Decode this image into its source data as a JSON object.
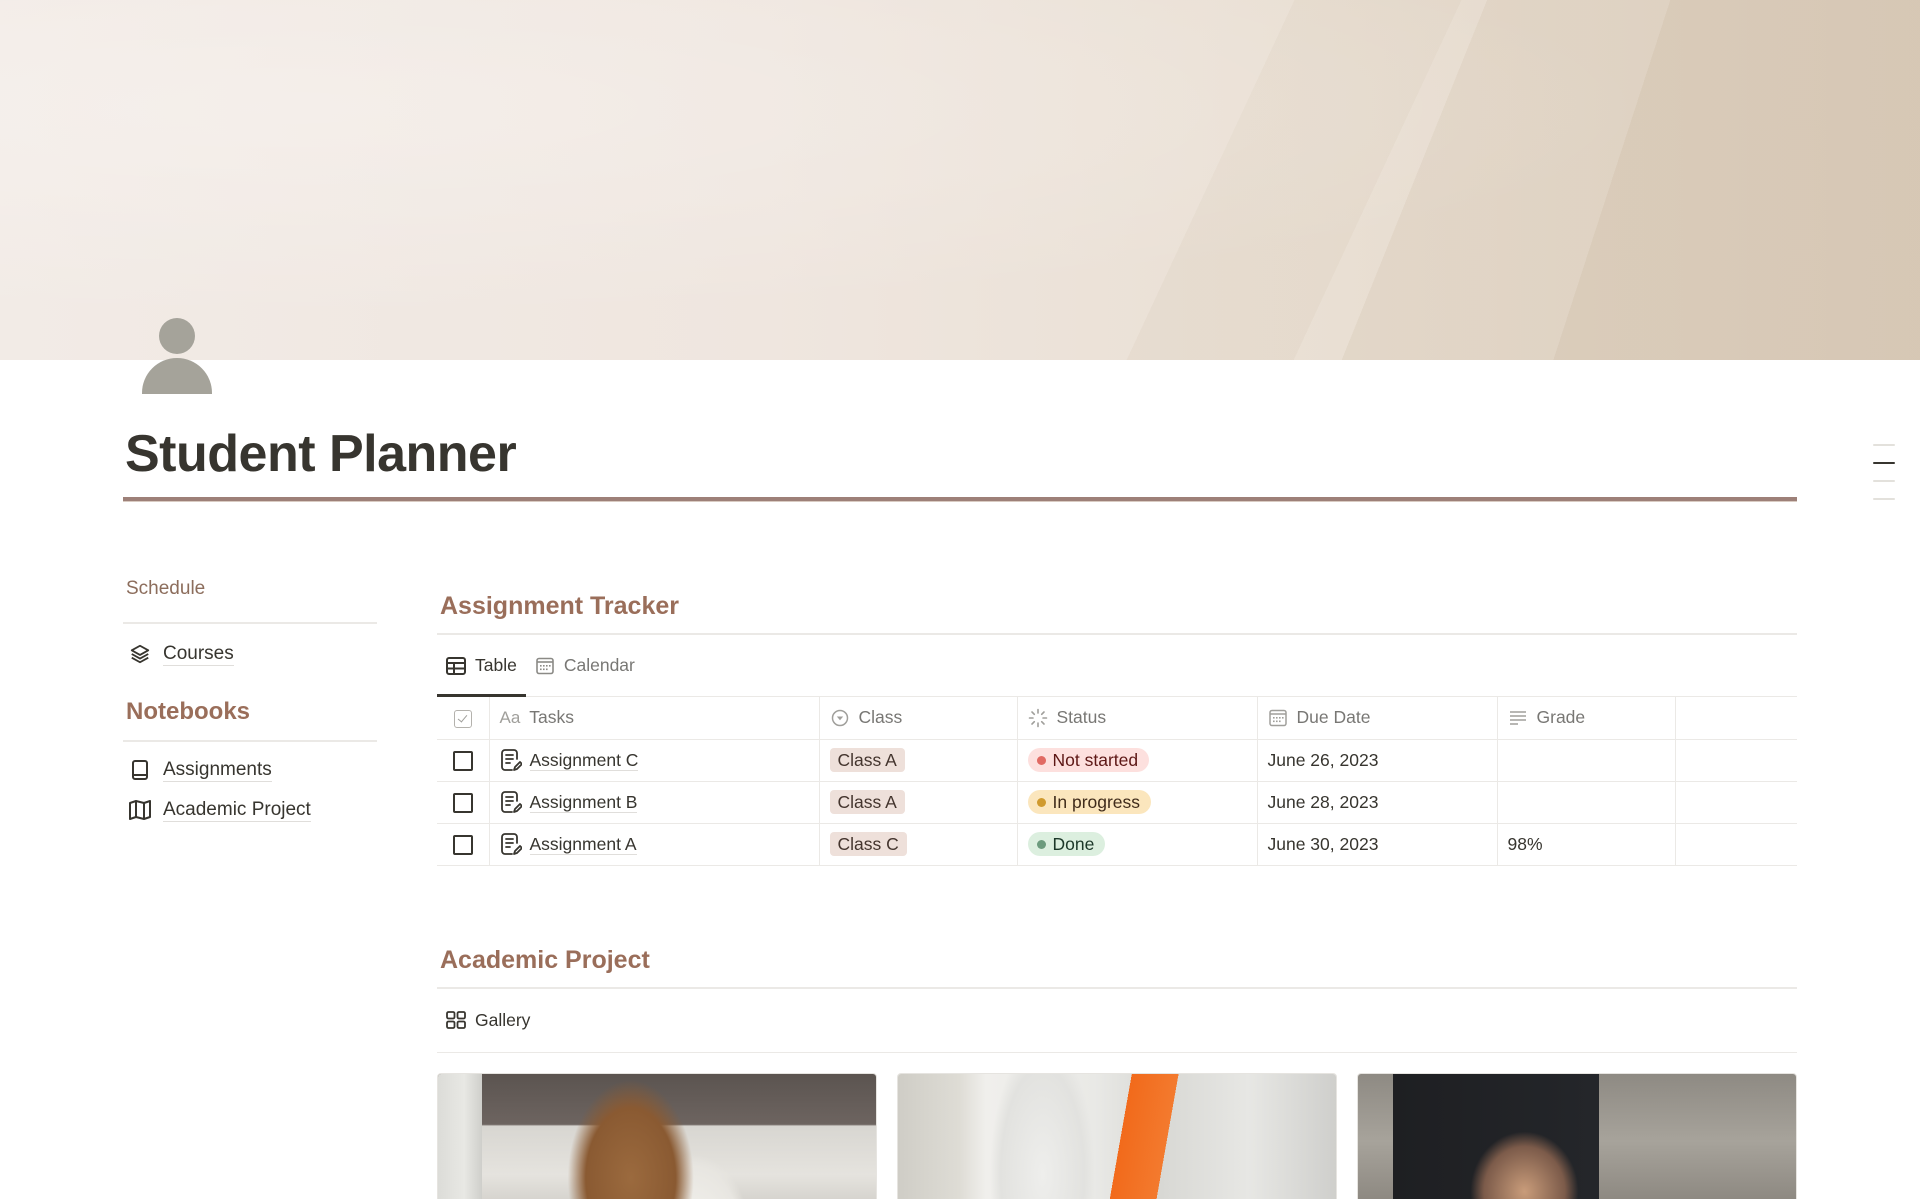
{
  "page": {
    "title": "Student Planner",
    "icon": "person-icon"
  },
  "sidebar": {
    "schedule_heading": "Schedule",
    "schedule_items": [
      {
        "label": "Courses",
        "icon": "layers-icon"
      }
    ],
    "notebooks_heading": "Notebooks",
    "notebook_items": [
      {
        "label": "Assignments",
        "icon": "book-icon"
      },
      {
        "label": "Academic Project",
        "icon": "map-icon"
      }
    ]
  },
  "assignment_tracker": {
    "title": "Assignment Tracker",
    "views": [
      {
        "label": "Table",
        "icon": "table-icon",
        "active": true
      },
      {
        "label": "Calendar",
        "icon": "calendar-icon",
        "active": false
      }
    ],
    "columns": [
      {
        "label": "",
        "icon": "checkbox-icon"
      },
      {
        "label": "Tasks",
        "icon": "text-icon"
      },
      {
        "label": "Class",
        "icon": "select-icon"
      },
      {
        "label": "Status",
        "icon": "status-icon"
      },
      {
        "label": "Due Date",
        "icon": "calendar-icon"
      },
      {
        "label": "Grade",
        "icon": "text-lines-icon"
      }
    ],
    "rows": [
      {
        "checked": false,
        "task": "Assignment C",
        "class": "Class A",
        "status": "Not started",
        "due_date": "June 26, 2023",
        "grade": ""
      },
      {
        "checked": false,
        "task": "Assignment B",
        "class": "Class A",
        "status": "In progress",
        "due_date": "June 28, 2023",
        "grade": ""
      },
      {
        "checked": false,
        "task": "Assignment A",
        "class": "Class C",
        "status": "Done",
        "due_date": "June 30, 2023",
        "grade": "98%"
      }
    ],
    "status_colors": {
      "Not started": {
        "bg": "#fde0de",
        "dot": "#e16a63",
        "text": "#5d1715"
      },
      "In progress": {
        "bg": "#fbe6bd",
        "dot": "#d09a2e",
        "text": "#402c1b"
      },
      "Done": {
        "bg": "#dcefdf",
        "dot": "#6c9b7d",
        "text": "#1c3829"
      }
    }
  },
  "academic_project": {
    "title": "Academic Project",
    "views": [
      {
        "label": "Gallery",
        "icon": "gallery-icon",
        "active": true
      }
    ],
    "cards": [
      {
        "image": "lab-researcher-photo"
      },
      {
        "image": "lab-gloves-photo"
      },
      {
        "image": "camera-filming-photo"
      }
    ]
  },
  "colors": {
    "accent": "#9a6e5a",
    "title_rule": "#9d8078",
    "text": "#37352f",
    "muted": "#787774",
    "tag_bg": "#eee0da"
  }
}
